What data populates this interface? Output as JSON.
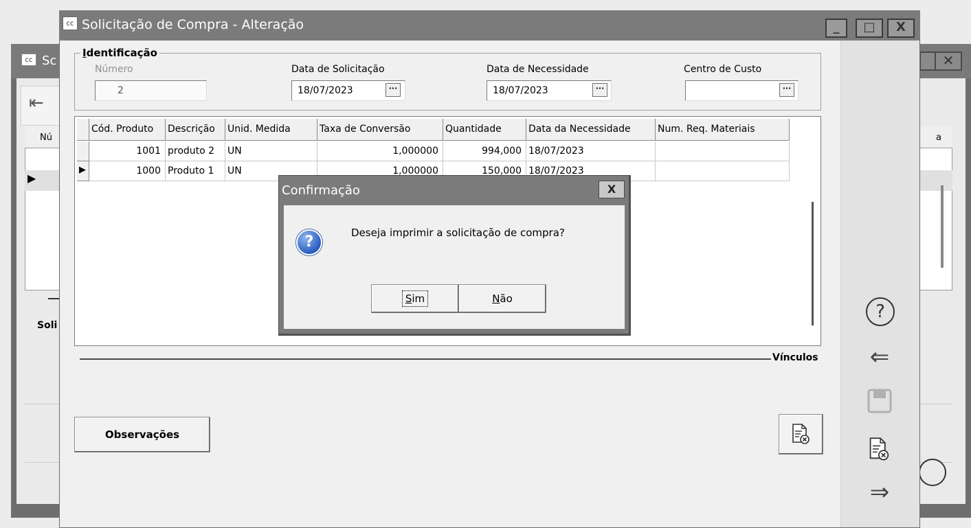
{
  "background_window": {
    "title": "Sc",
    "icon": "cc",
    "grid_header_left": "Nú",
    "grid_header_right": "a",
    "tab_label": "Soli"
  },
  "window": {
    "icon": "cc",
    "title": "Solicitação de Compra - Alteração",
    "controls": {
      "minimize": "_",
      "maximize": "□",
      "close": "X"
    }
  },
  "identificacao": {
    "legend": "Identificação",
    "numero": {
      "label": "Número",
      "value": "2"
    },
    "data_solicitacao": {
      "label": "Data de Solicitação",
      "value": "18/07/2023",
      "button": "···"
    },
    "data_necessidade": {
      "label": "Data de Necessidade",
      "value": "18/07/2023",
      "button": "···"
    },
    "centro_custo": {
      "label": "Centro de Custo",
      "value": "",
      "button": "···"
    }
  },
  "grid": {
    "columns": [
      "Cód. Produto",
      "Descrição",
      "Unid. Medida",
      "Taxa de Conversão",
      "Quantidade",
      "Data da Necessidade",
      "Num. Req. Materiais"
    ],
    "rows": [
      {
        "codigo": "1001",
        "descricao": "produto 2",
        "unidade": "UN",
        "taxa": "1,000000",
        "quantidade": "994,000",
        "data": "18/07/2023",
        "req": ""
      },
      {
        "codigo": "1000",
        "descricao": "Produto 1",
        "unidade": "UN",
        "taxa": "1,000000",
        "quantidade": "150,000",
        "data": "18/07/2023",
        "req": ""
      }
    ],
    "current_row_indicator": "▶"
  },
  "vinculos": {
    "label": "Vínculos"
  },
  "observacoes_button": "Observações",
  "right_panel": {
    "help_icon": "?",
    "back_icon": "⇐",
    "save_icon": "save",
    "cancel_icon": "cancel-document",
    "forward_icon": "⇒"
  },
  "dialog": {
    "title": "Confirmação",
    "close": "X",
    "icon": "?",
    "message": "Deseja imprimir a solicitação de compra?",
    "yes_underlined": "S",
    "yes_rest": "im",
    "no_underlined": "N",
    "no_rest": "ão"
  }
}
